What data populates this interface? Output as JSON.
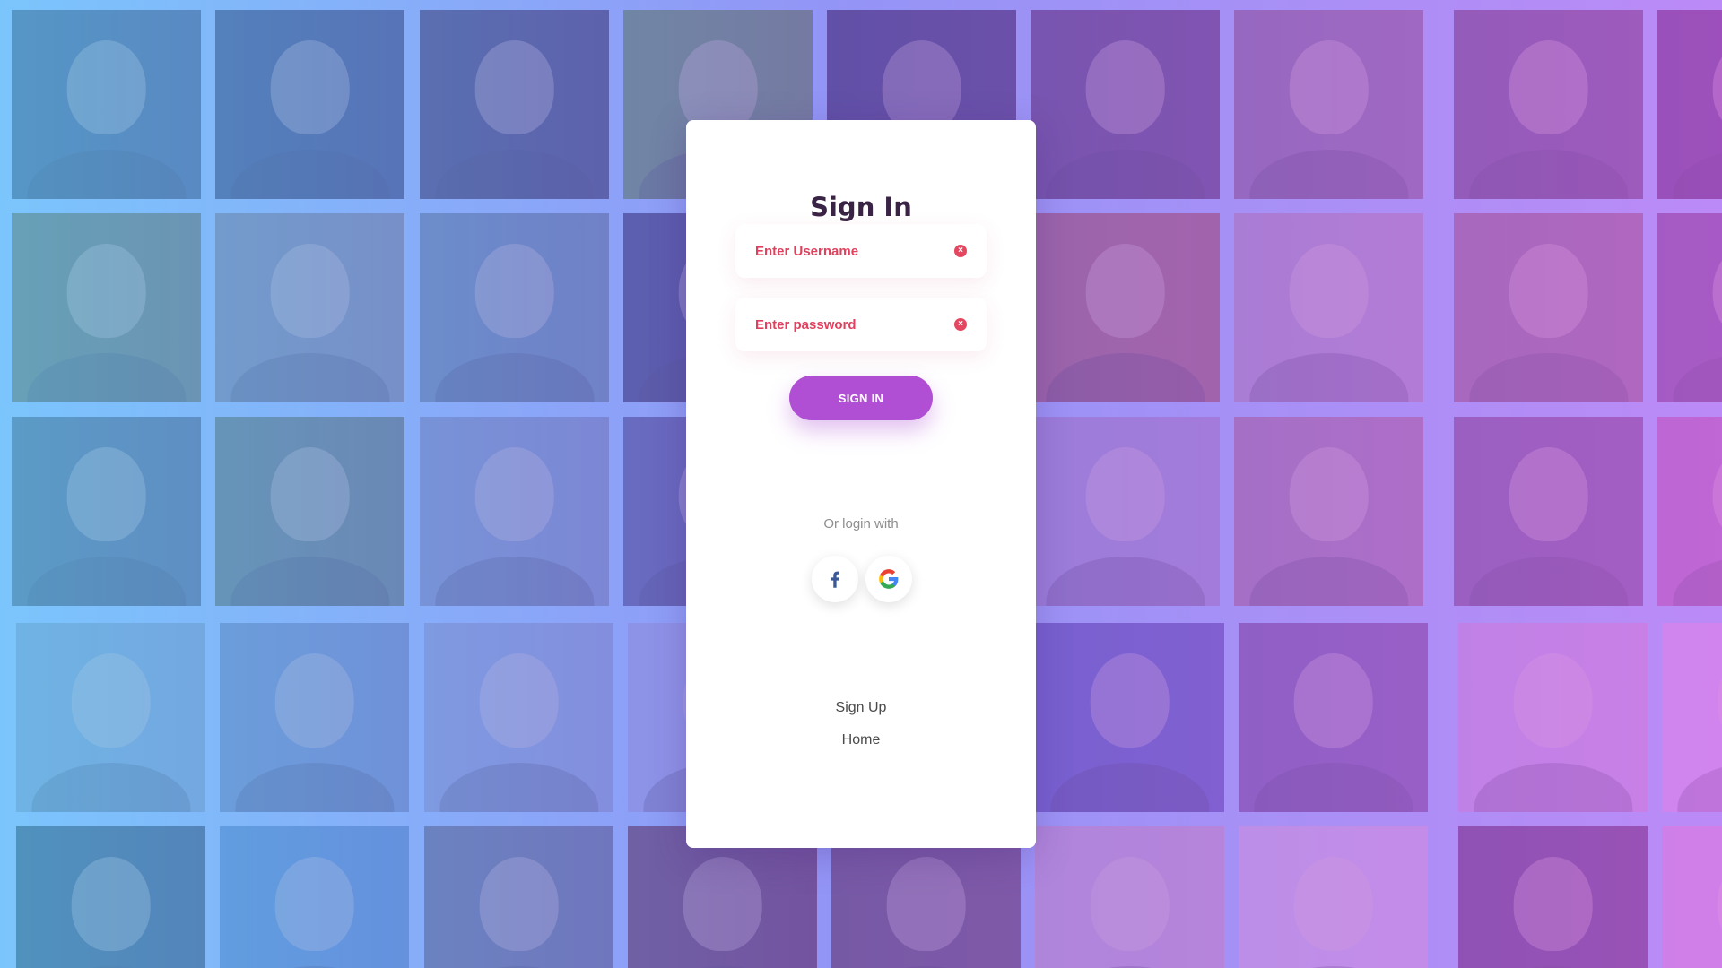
{
  "signin": {
    "title": "Sign In",
    "username_placeholder": "Enter Username",
    "password_placeholder": "Enter password",
    "button_label": "SIGN IN",
    "or_text": "Or login with",
    "social": [
      "facebook-icon",
      "google-icon"
    ],
    "links": {
      "signup": "Sign Up",
      "home": "Home"
    }
  },
  "colors": {
    "accent": "#b04fd4",
    "input_text": "#e0405d",
    "title": "#3a2446",
    "facebook": "#3b5998"
  }
}
